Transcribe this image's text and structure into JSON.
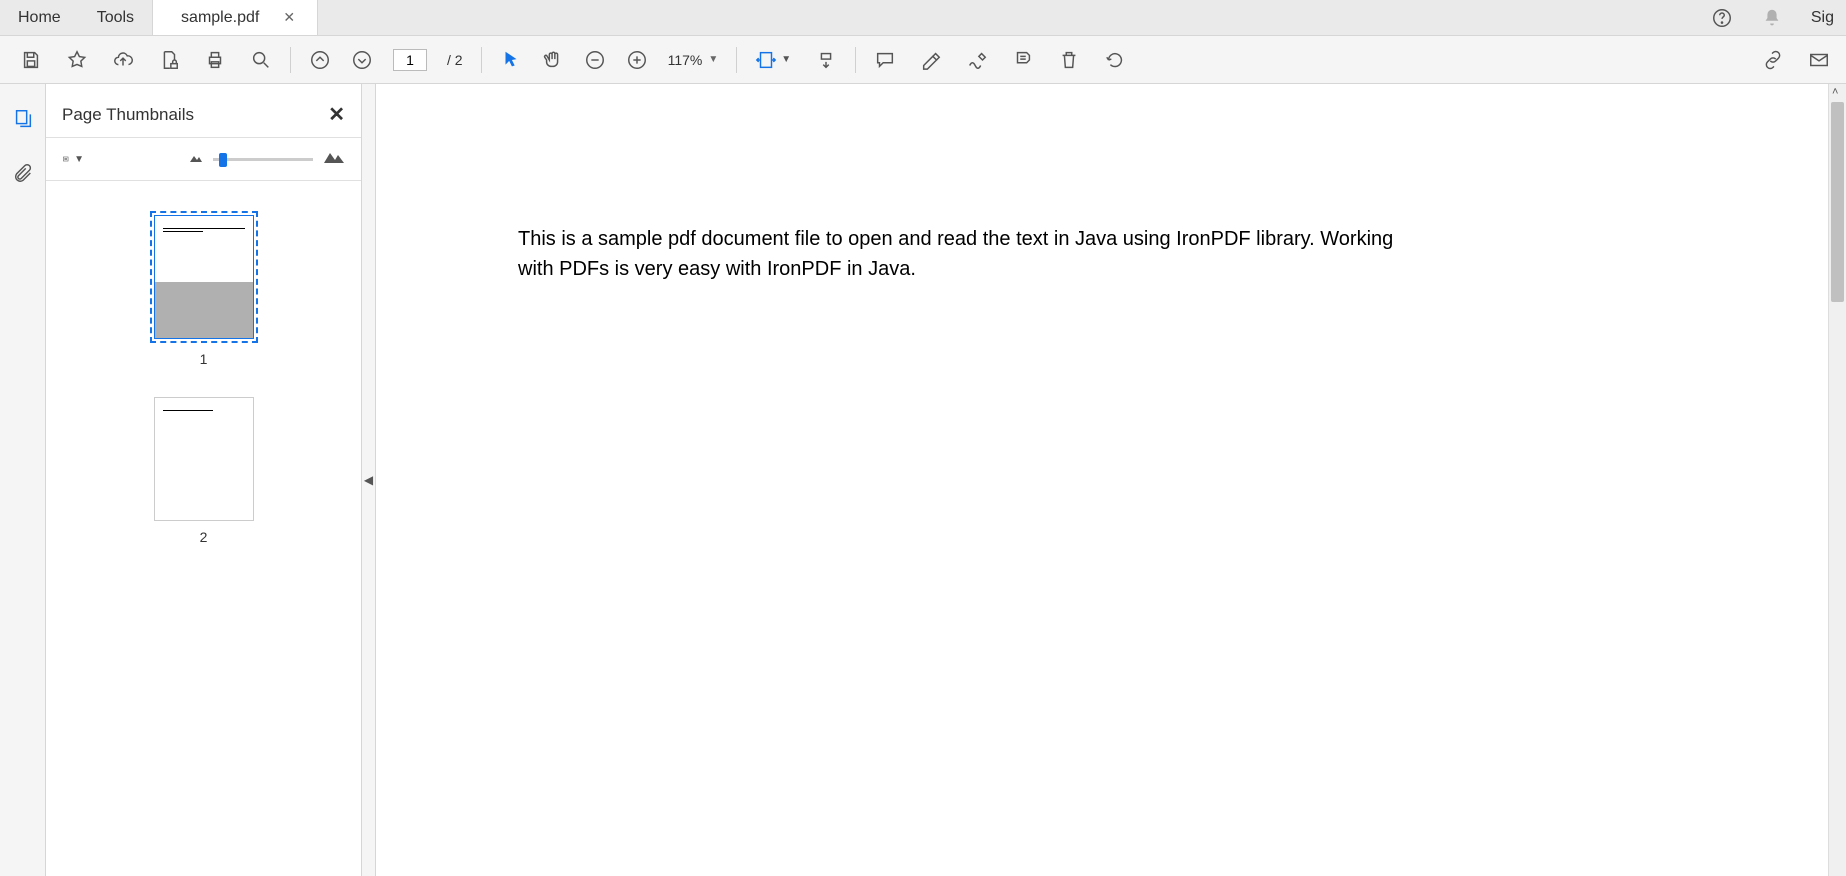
{
  "topbar": {
    "home": "Home",
    "tools": "Tools",
    "doc_title": "sample.pdf",
    "sign": "Sig"
  },
  "toolbar": {
    "page_current": "1",
    "page_total": "/ 2",
    "zoom_value": "117%"
  },
  "thumbnails": {
    "title": "Page Thumbnails",
    "pages": [
      {
        "num": "1"
      },
      {
        "num": "2"
      }
    ]
  },
  "document": {
    "content": "This is a sample pdf document file to open and read the text in Java using IronPDF library. Working with PDFs is very easy with IronPDF in Java."
  }
}
